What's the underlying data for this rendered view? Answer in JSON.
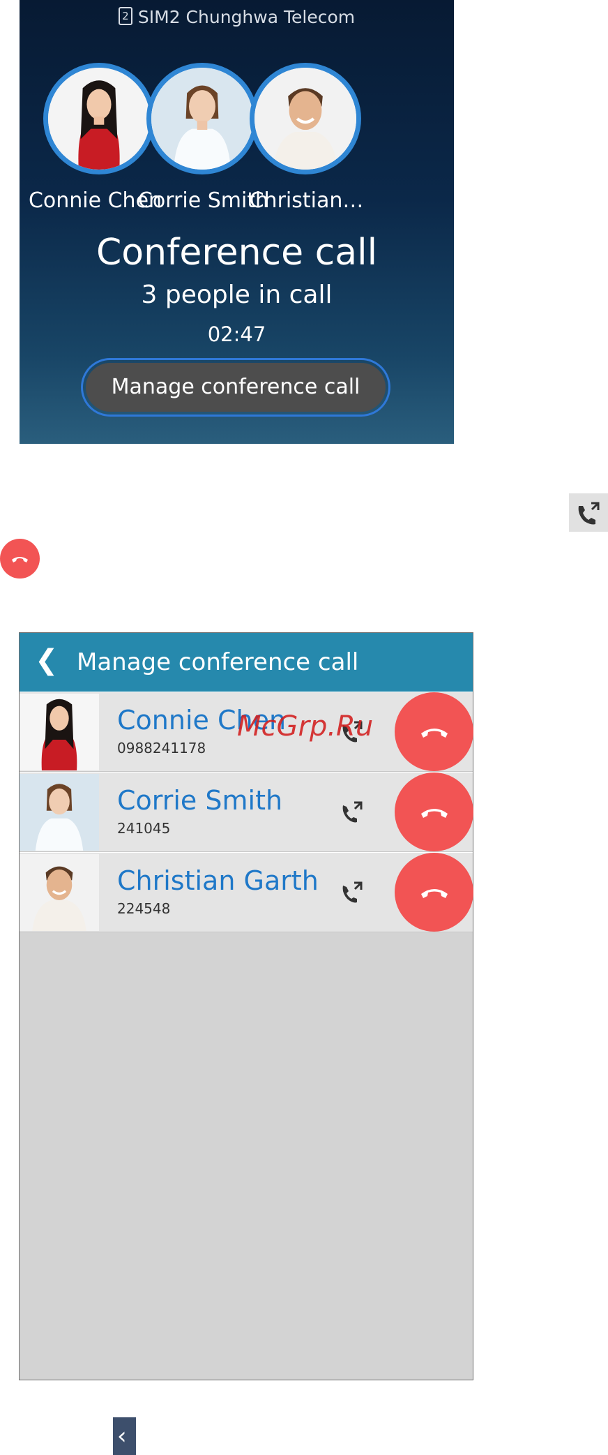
{
  "call_screen": {
    "sim_slot": "2",
    "sim_text": "SIM2   Chunghwa Telecom",
    "participants": [
      {
        "name": "Connie Chen",
        "avatar": "woman-red-dress-avatar"
      },
      {
        "name": "Corrie Smith",
        "avatar": "woman-white-shirt-avatar"
      },
      {
        "name": "Christian…",
        "avatar": "man-smiling-avatar"
      }
    ],
    "title": "Conference call",
    "people_count": "3 people in call",
    "timer": "02:47",
    "manage_button_label": "Manage conference call"
  },
  "floating_icons": {
    "merge_icon": "call-split-icon",
    "end_icon": "end-call-icon"
  },
  "manage_screen": {
    "back_icon": "back-chevron-icon",
    "title": "Manage conference call",
    "rows": [
      {
        "name": "Connie Chen",
        "number": "0988241178"
      },
      {
        "name": "Corrie Smith",
        "number": "241045"
      },
      {
        "name": "Christian Garth",
        "number": "224548"
      }
    ]
  },
  "watermark": "McGrp.Ru",
  "colors": {
    "accent_blue": "#2f86d4",
    "header_teal": "#2689ad",
    "end_red": "#f25454",
    "name_blue": "#1f78c8"
  }
}
